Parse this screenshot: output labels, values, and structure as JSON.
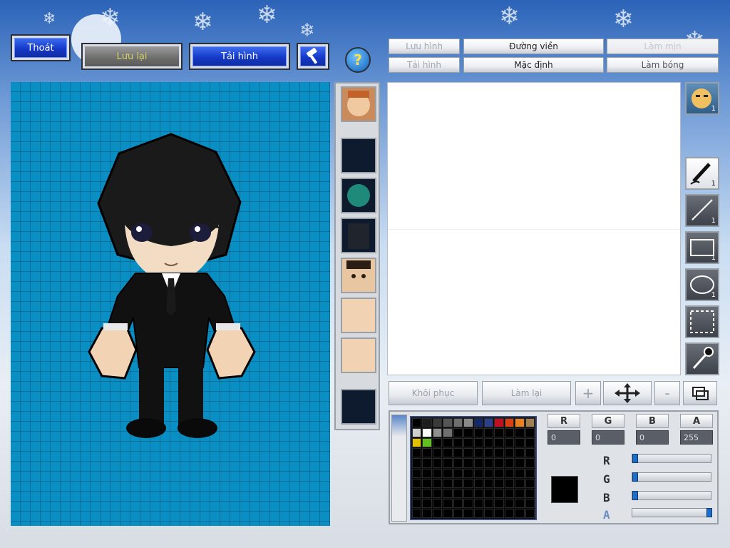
{
  "top_buttons": {
    "exit": "Thoát",
    "save": "Lưu lại",
    "reload_image": "Tải hình",
    "help": "?"
  },
  "right_toolbar": {
    "save_image": "Lưu hình",
    "outline": "Đường viền",
    "smooth": "Làm mịn",
    "reload_image": "Tải hình",
    "default": "Mặc định",
    "shadow": "Làm bóng"
  },
  "actions": {
    "restore": "Khôi phục",
    "redo": "Làm lại",
    "plus": "+",
    "minus": "-"
  },
  "tools": {
    "face_count": "1",
    "brush_count": "1",
    "line_count": "1",
    "rect_count": "1",
    "ellipse_count": "1"
  },
  "color": {
    "r_label": "R",
    "g_label": "G",
    "b_label": "B",
    "a_label": "A",
    "r_value": "0",
    "g_value": "0",
    "b_value": "0",
    "a_value": "255",
    "current": "#000000",
    "slider_r": 0,
    "slider_g": 0,
    "slider_b": 0,
    "slider_a": 1.0
  },
  "palette_row1": [
    "#000000",
    "#1e1e1e",
    "#3a3a3a",
    "#555555",
    "#6e6e6e",
    "#8a8a8a",
    "#12286a",
    "#2b3f8c",
    "#c01020",
    "#d94010",
    "#e88020",
    "#a08050"
  ],
  "palette_row2": [
    "#cfcfcf",
    "#ffffff",
    "#909090",
    "#707070",
    "#000000",
    "#000000",
    "#000000",
    "#000000",
    "#000000",
    "#000000",
    "#000000",
    "#000000"
  ],
  "palette_row3": [
    "#e0c000",
    "#60c020",
    "#000000",
    "#000000",
    "#000000",
    "#000000",
    "#000000",
    "#000000",
    "#000000",
    "#000000",
    "#000000",
    "#000000"
  ],
  "colors": {
    "canvas_bg": "#0a8fc4",
    "button_blue": "#1539c9",
    "slider_knob": "#1b6fc9"
  }
}
